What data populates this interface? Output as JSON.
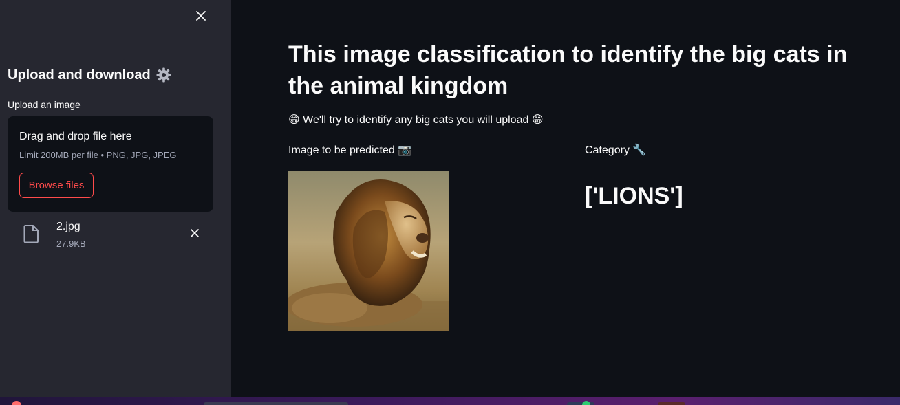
{
  "sidebar": {
    "header": "Upload and download",
    "header_icon": "gear-icon",
    "upload_label": "Upload an image",
    "dropzone": {
      "title": "Drag and drop file here",
      "limit": "Limit 200MB per file • PNG, JPG, JPEG",
      "browse_label": "Browse files"
    },
    "file": {
      "name": "2.jpg",
      "size": "27.9KB"
    }
  },
  "main": {
    "title": "This image classification to identify the big cats in the animal kingdom",
    "subtitle": "😁 We'll try to identify any big cats you will upload 😁",
    "image_label": "Image to be predicted 📷",
    "category_label": "Category 🔧",
    "prediction": "['LIONS']"
  },
  "colors": {
    "sidebar_bg": "#262730",
    "main_bg": "#0e1117",
    "accent": "#ff4b4b",
    "text": "#fafafa",
    "muted_text": "#a3a8b8"
  }
}
